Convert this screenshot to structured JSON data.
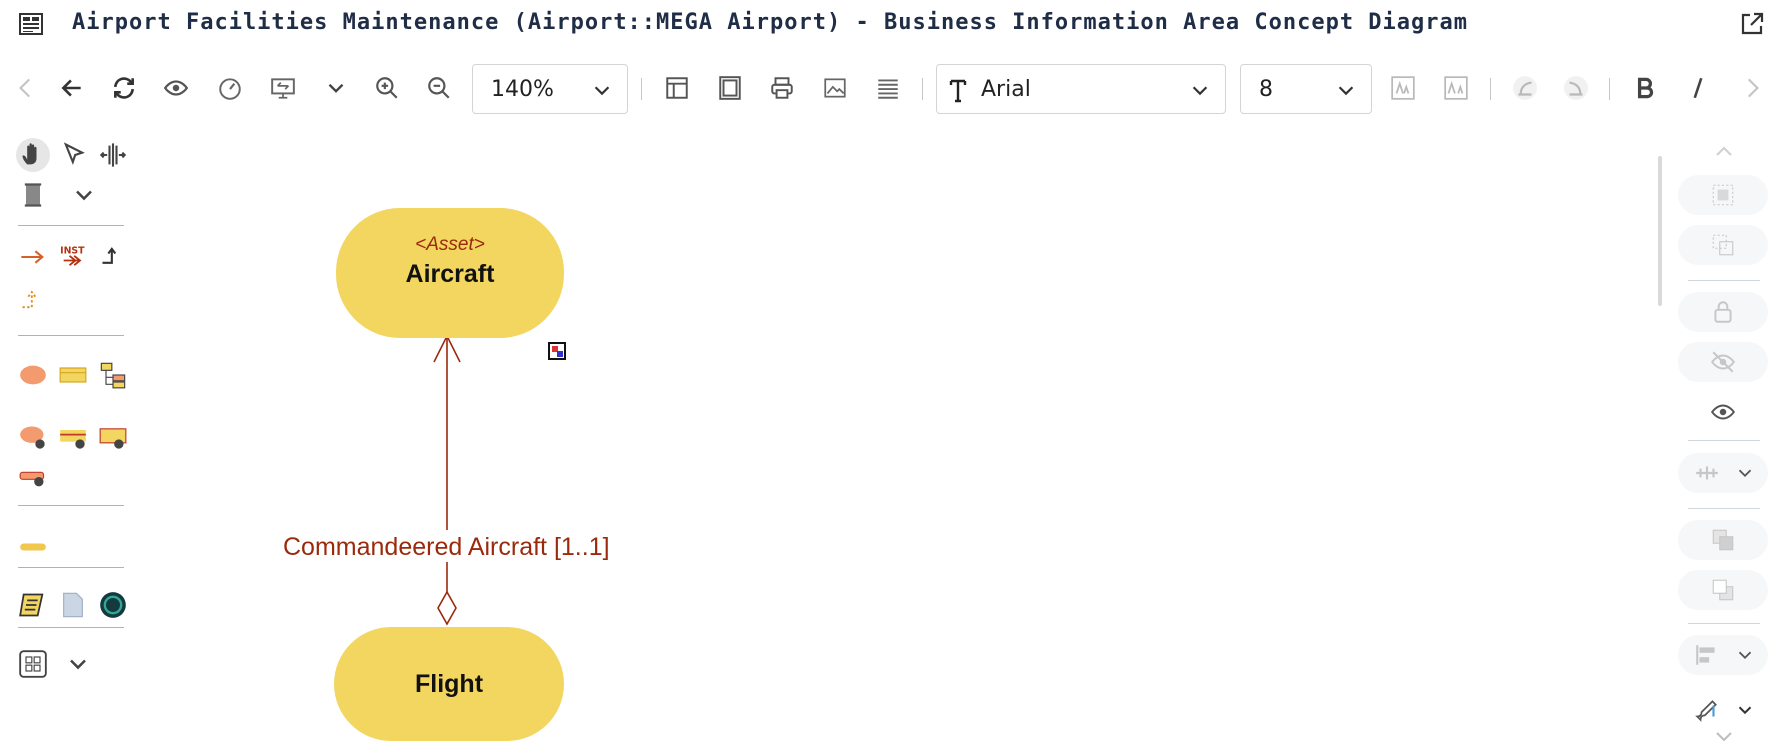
{
  "window": {
    "title": "Airport Facilities Maintenance (Airport::MEGA Airport) - Business Information Area Concept Diagram",
    "title_icon": "diagram-icon",
    "popout_icon": "external-link-icon"
  },
  "toolbar": {
    "zoom_value": "140%",
    "font_family_value": "Arial",
    "font_size_value": "8",
    "icons": [
      "back-icon",
      "undo-icon",
      "refresh-icon",
      "view-icon",
      "speedometer-icon",
      "fit-screen-icon",
      "chevron-down-icon",
      "zoom-in-icon",
      "zoom-out-icon",
      "layout-icon",
      "frame-icon",
      "print-icon",
      "image-icon",
      "list-icon",
      "text-font-icon",
      "font-grow-icon",
      "font-shrink-icon",
      "rotate-left-icon",
      "rotate-right-icon",
      "bold-icon",
      "italic-icon",
      "forward-icon"
    ]
  },
  "diagram": {
    "nodes": [
      {
        "id": "aircraft",
        "stereotype": "<Asset>",
        "name": "Aircraft"
      },
      {
        "id": "flight",
        "stereotype": "",
        "name": "Flight"
      }
    ],
    "association": {
      "label": "Commandeered Aircraft [1..1]",
      "from": "flight",
      "to": "aircraft",
      "type": "aggregation"
    }
  },
  "colors": {
    "node_fill": "#f2d660",
    "stereotype_text": "#9b2a0c",
    "association_line": "#9b2a0c",
    "title_text": "#1f2d47",
    "toolbar_icon": "#3c3c3c",
    "disabled_icon": "#b9b9b9"
  }
}
